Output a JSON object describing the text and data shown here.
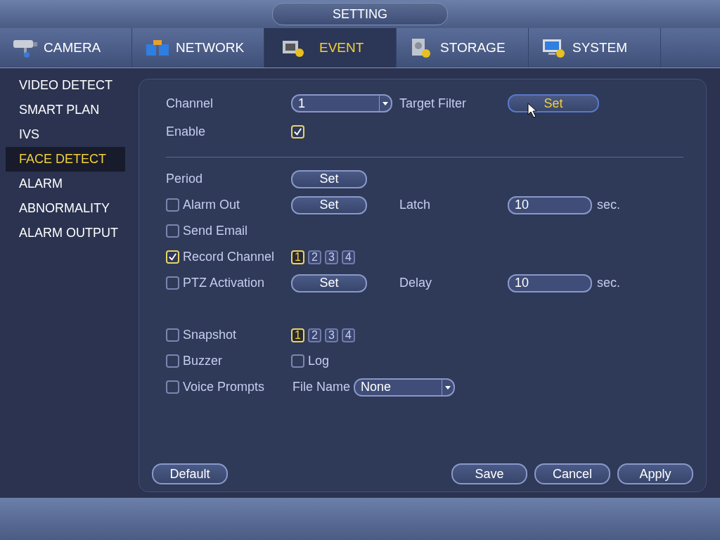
{
  "title": "SETTING",
  "tabs": [
    {
      "label": "CAMERA",
      "kind": "camera",
      "selected": false
    },
    {
      "label": "NETWORK",
      "kind": "network",
      "selected": false
    },
    {
      "label": "EVENT",
      "kind": "event",
      "selected": true
    },
    {
      "label": "STORAGE",
      "kind": "storage",
      "selected": false
    },
    {
      "label": "SYSTEM",
      "kind": "system",
      "selected": false
    }
  ],
  "sidebar": {
    "items": [
      {
        "label": "VIDEO DETECT",
        "selected": false
      },
      {
        "label": "SMART PLAN",
        "selected": false
      },
      {
        "label": "IVS",
        "selected": false
      },
      {
        "label": "FACE DETECT",
        "selected": true
      },
      {
        "label": "ALARM",
        "selected": false
      },
      {
        "label": "ABNORMALITY",
        "selected": false
      },
      {
        "label": "ALARM OUTPUT",
        "selected": false
      }
    ]
  },
  "form": {
    "channel": {
      "label": "Channel",
      "value": "1"
    },
    "target_filter": {
      "label": "Target Filter",
      "button": "Set",
      "focused": true
    },
    "enable": {
      "label": "Enable",
      "checked": true
    },
    "groups": [
      [
        {
          "label": "Period",
          "button": "Set"
        },
        {
          "label": "Alarm Out",
          "checked": false,
          "button": "Set",
          "side": {
            "label": "Latch",
            "value": "10",
            "unit": "sec."
          }
        },
        {
          "label": "Send Email",
          "checked": false
        },
        {
          "label": "Record Channel",
          "checked": true,
          "channels": [
            {
              "label": "1",
              "selected": true
            },
            {
              "label": "2",
              "selected": false
            },
            {
              "label": "3",
              "selected": false
            },
            {
              "label": "4",
              "selected": false
            }
          ]
        },
        {
          "label": "PTZ Activation",
          "checked": false,
          "button": "Set",
          "side": {
            "label": "Delay",
            "value": "10",
            "unit": "sec."
          }
        }
      ],
      [
        {
          "label": "Snapshot",
          "checked": false,
          "channels": [
            {
              "label": "1",
              "selected": true
            },
            {
              "label": "2",
              "selected": false
            },
            {
              "label": "3",
              "selected": false
            },
            {
              "label": "4",
              "selected": false
            }
          ]
        },
        {
          "label": "Buzzer",
          "checked": false,
          "log": {
            "label": "Log",
            "checked": false
          }
        },
        {
          "label": "Voice Prompts",
          "checked": false,
          "file_name": {
            "label": "File Name",
            "value": "None"
          }
        }
      ]
    ]
  },
  "buttons": {
    "left": [
      "Default"
    ],
    "right": [
      "Save",
      "Cancel",
      "Apply"
    ]
  }
}
